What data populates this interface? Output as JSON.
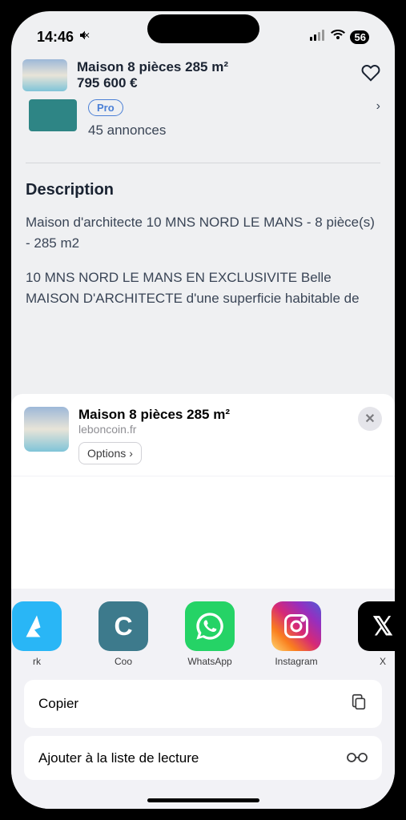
{
  "status": {
    "time": "14:46",
    "battery": "56"
  },
  "listing": {
    "title": "Maison 8 pièces 285 m²",
    "price": "795 600 €"
  },
  "seller": {
    "badge": "Pro",
    "count": "45 annonces"
  },
  "description": {
    "heading": "Description",
    "line1": "Maison d'architecte 10 MNS NORD LE MANS - 8 pièce(s) - 285 m2",
    "line2": "10 MNS NORD LE MANS EN EXCLUSIVITE Belle MAISON D'ARCHITECTE d'une superficie habitable de"
  },
  "share": {
    "title": "Maison 8 pièces 285 m²",
    "domain": "leboncoin.fr",
    "options": "Options",
    "apps": [
      {
        "label": "rk"
      },
      {
        "label": "Coo"
      },
      {
        "label": "WhatsApp"
      },
      {
        "label": "Instagram"
      },
      {
        "label": "X"
      }
    ],
    "actions": {
      "copy": "Copier",
      "reading_list": "Ajouter à la liste de lecture"
    }
  }
}
